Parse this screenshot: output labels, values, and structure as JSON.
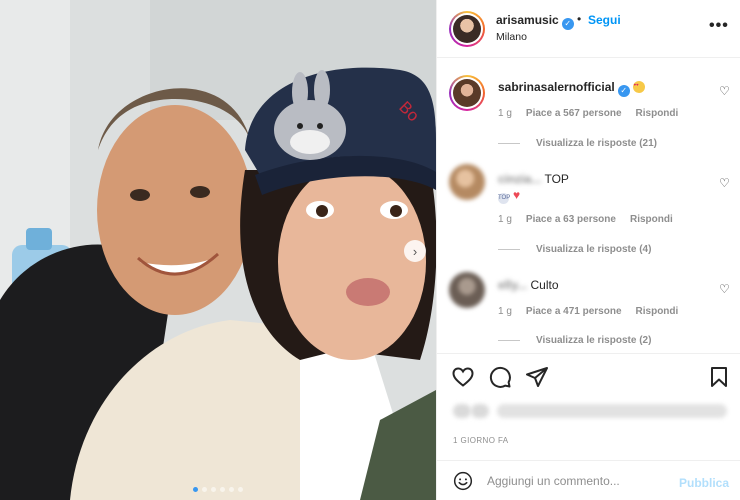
{
  "post": {
    "username": "arisamusic",
    "follow_label": "Segui",
    "bullet": "•",
    "location": "Milano",
    "more_label": "•••",
    "next_label": "›",
    "slide_count": 6,
    "active_slide": 1
  },
  "comments": [
    {
      "username": "sabrinasalernofficial",
      "verified": true,
      "text": "",
      "emoji": "smiling-face-with-heart-eyes",
      "time": "1 g",
      "likes": "Piace a 567 persone",
      "reply_label": "Rispondi",
      "replies": "Visualizza le risposte (21)"
    },
    {
      "username": "cinzia...",
      "blurred_username": true,
      "text": "TOP",
      "sticker": "TOP",
      "emoji": "red-heart",
      "time": "1 g",
      "likes": "Piace a 63 persone",
      "reply_label": "Rispondi",
      "replies": "Visualizza le risposte (4)"
    },
    {
      "username": "elly...",
      "blurred_username": true,
      "text": "Culto",
      "time": "1 g",
      "likes": "Piace a 471 persone",
      "reply_label": "Rispondi",
      "replies": "Visualizza le risposte (2)"
    }
  ],
  "actions": {
    "icons": [
      "heart-icon",
      "comment-icon",
      "share-icon",
      "bookmark-icon"
    ],
    "timestamp": "1 GIORNO FA"
  },
  "composer": {
    "placeholder": "Aggiungi un commento...",
    "publish_label": "Pubblica"
  },
  "colors": {
    "accent": "#0095f6",
    "publish_disabled": "#b2dffc",
    "muted": "#8e8e8e",
    "text": "#262626"
  }
}
